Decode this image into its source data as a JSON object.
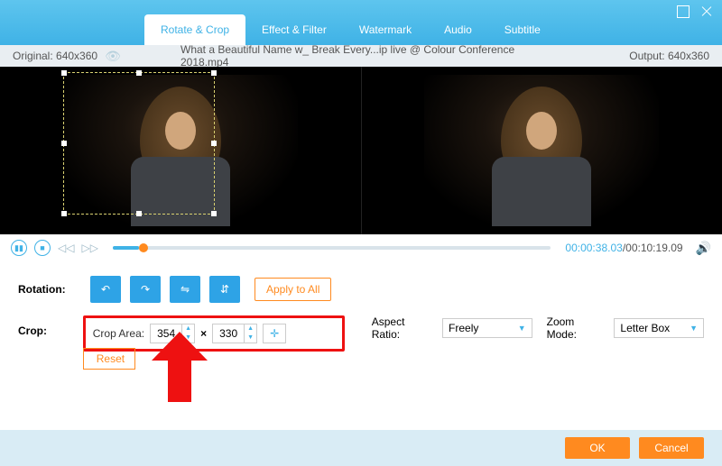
{
  "tabs": [
    "Rotate & Crop",
    "Effect & Filter",
    "Watermark",
    "Audio",
    "Subtitle"
  ],
  "activeTab": 0,
  "info": {
    "original": "Original: 640x360",
    "filename": "What a Beautiful Name w_ Break Every...ip live @ Colour Conference 2018.mp4",
    "output": "Output: 640x360"
  },
  "player": {
    "current": "00:00:38.03",
    "total": "00:10:19.09"
  },
  "rotation": {
    "label": "Rotation:",
    "apply": "Apply to All"
  },
  "crop": {
    "label": "Crop:",
    "areaLabel": "Crop Area:",
    "w": "354",
    "h": "330",
    "aspectLabel": "Aspect Ratio:",
    "aspectValue": "Freely",
    "zoomLabel": "Zoom Mode:",
    "zoomValue": "Letter Box"
  },
  "reset": "Reset",
  "footer": {
    "ok": "OK",
    "cancel": "Cancel"
  },
  "icons": {
    "rot_ccw": "↶",
    "rot_cw": "↷",
    "flip_h": "⇋",
    "flip_v": "⇵",
    "pause": "▮▮",
    "stop": "■",
    "prev": "◁◁",
    "next": "▷▷",
    "eye": "👁",
    "vol": "🔊",
    "center": "✛",
    "up": "▲",
    "down": "▼",
    "caret": "▼"
  }
}
